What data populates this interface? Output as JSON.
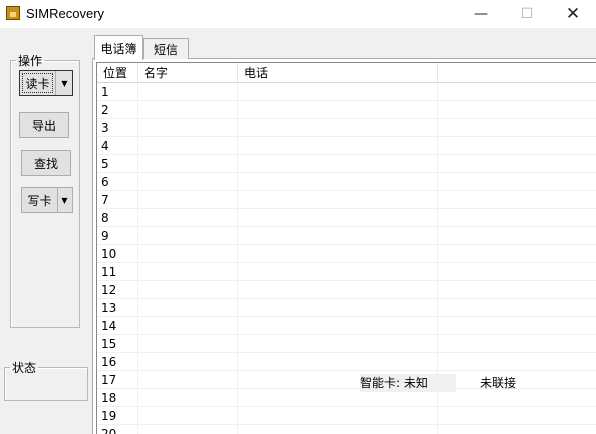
{
  "window": {
    "title": "SIMRecovery",
    "minimize_glyph": "—",
    "maximize_glyph": "☐",
    "close_glyph": "✕",
    "app_icon": "sim-card-icon"
  },
  "operations": {
    "legend": "操作",
    "read_card": "读卡",
    "export": "导出",
    "find": "查找",
    "write_card": "写卡",
    "dropdown_glyph": "▼"
  },
  "status_group": {
    "legend": "状态"
  },
  "tabs": [
    {
      "label": "电话簿",
      "active": true
    },
    {
      "label": "短信",
      "active": false
    }
  ],
  "table": {
    "columns": [
      "位置",
      "名字",
      "电话",
      ""
    ],
    "rows": [
      "1",
      "2",
      "3",
      "4",
      "5",
      "6",
      "7",
      "8",
      "9",
      "10",
      "11",
      "12",
      "13",
      "14",
      "15",
      "16",
      "17",
      "18",
      "19",
      "20"
    ]
  },
  "status_bar": {
    "smart_card": "智能卡: 未知",
    "connection": "未联接"
  }
}
